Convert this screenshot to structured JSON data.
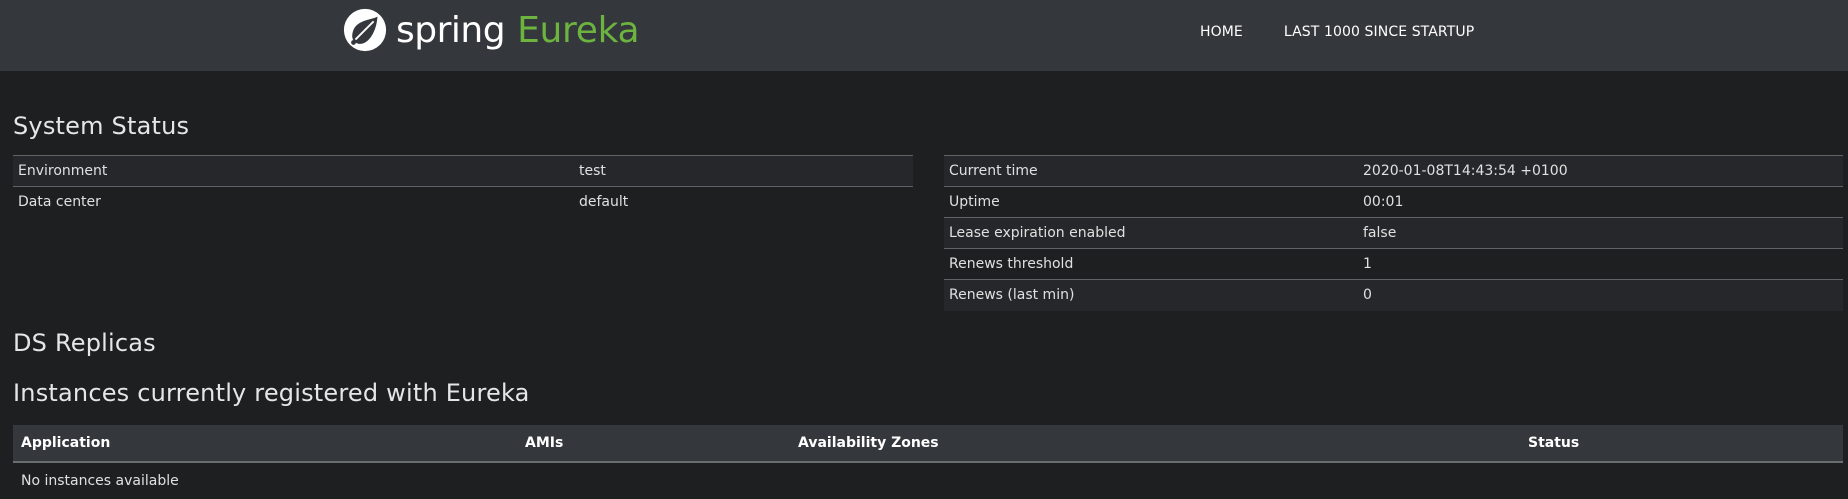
{
  "navbar": {
    "brand_spring": "spring",
    "brand_eureka": "Eureka",
    "links": [
      {
        "label": "HOME"
      },
      {
        "label": "LAST 1000 SINCE STARTUP"
      }
    ],
    "colors": {
      "background": "#34373b",
      "eureka_green": "#6db33f"
    }
  },
  "system_status": {
    "title": "System Status",
    "left": [
      {
        "key": "Environment",
        "value": "test"
      },
      {
        "key": "Data center",
        "value": "default"
      }
    ],
    "right": [
      {
        "key": "Current time",
        "value": "2020-01-08T14:43:54 +0100"
      },
      {
        "key": "Uptime",
        "value": "00:01"
      },
      {
        "key": "Lease expiration enabled",
        "value": "false"
      },
      {
        "key": "Renews threshold",
        "value": "1"
      },
      {
        "key": "Renews (last min)",
        "value": "0"
      }
    ]
  },
  "ds_replicas": {
    "title": "DS Replicas"
  },
  "instances": {
    "title": "Instances currently registered with Eureka",
    "columns": [
      "Application",
      "AMIs",
      "Availability Zones",
      "Status"
    ],
    "empty_message": "No instances available"
  }
}
